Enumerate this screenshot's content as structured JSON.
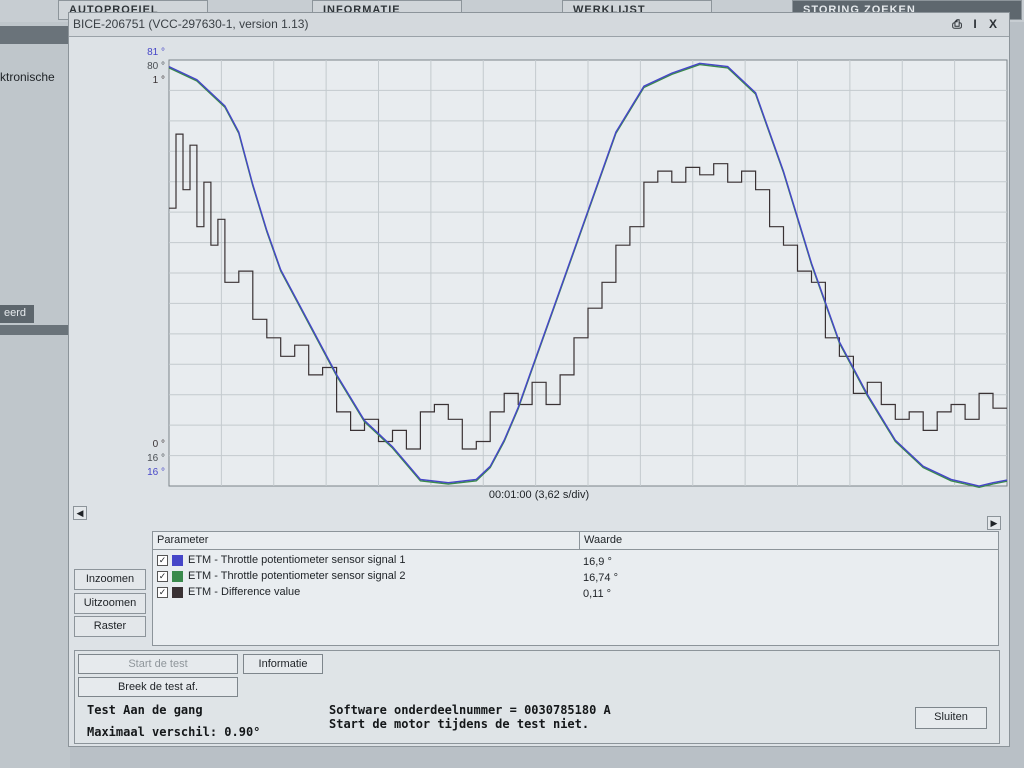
{
  "top_tabs": [
    "AUTOPROFIEL",
    "INFORMATIE",
    "WERKLIJST",
    "STORING ZOEKEN"
  ],
  "left_nav": {
    "label": "ktronische",
    "tab": "eerd"
  },
  "window": {
    "title": "BICE-206751 (VCC-297630-1, version 1.13)",
    "buttons": [
      "I",
      "X"
    ]
  },
  "colors": {
    "signal1": "#4646c8",
    "signal2": "#3a8a4c",
    "difference": "#3a3234"
  },
  "chart_data": {
    "type": "line",
    "x_label": "00:01:00 (3,62 s/div)",
    "y_top_labels": [
      {
        "text": "81 °",
        "color": "#4646c8"
      },
      {
        "text": "80 °",
        "color": "#4a4f54"
      },
      {
        "text": "1 °",
        "color": "#3a3234"
      }
    ],
    "y_bottom_labels": [
      {
        "text": "0 °",
        "color": "#3a3234"
      },
      {
        "text": "16 °",
        "color": "#4a4f54"
      },
      {
        "text": "16 °",
        "color": "#4646c8"
      }
    ],
    "grid": true,
    "x_range_s": [
      0,
      60
    ],
    "series": [
      {
        "name": "ETM - Throttle potentiometer sensor signal 1",
        "color": "#4646c8",
        "x": [
          0,
          2,
          4,
          5,
          6,
          7,
          8,
          9,
          10,
          12,
          14,
          16,
          18,
          20,
          22,
          23,
          24,
          25,
          26,
          28,
          30,
          32,
          34,
          36,
          38,
          40,
          42,
          44,
          46,
          48,
          50,
          52,
          54,
          56,
          57,
          58,
          59,
          60
        ],
        "y": [
          80,
          78,
          74,
          70,
          62,
          55,
          49,
          45,
          41,
          33,
          26,
          22,
          17,
          16.5,
          17,
          19,
          23,
          28,
          34,
          46,
          58,
          70,
          77,
          79,
          80.5,
          80,
          76,
          64,
          50,
          38,
          30,
          23,
          19,
          17,
          16.5,
          16,
          16.5,
          16.9
        ]
      },
      {
        "name": "ETM - Throttle potentiometer sensor signal 2",
        "color": "#3a8a4c",
        "x": [
          0,
          2,
          4,
          5,
          6,
          7,
          8,
          9,
          10,
          12,
          14,
          16,
          18,
          20,
          22,
          23,
          24,
          25,
          26,
          28,
          30,
          32,
          34,
          36,
          38,
          40,
          42,
          44,
          46,
          48,
          50,
          52,
          54,
          56,
          57,
          58,
          59,
          60
        ],
        "y": [
          79.8,
          77.8,
          73.8,
          69.8,
          61.8,
          54.8,
          48.8,
          44.8,
          40.8,
          32.8,
          25.8,
          21.8,
          16.8,
          16.3,
          16.8,
          18.8,
          22.8,
          27.8,
          33.8,
          45.8,
          57.8,
          69.8,
          76.8,
          78.8,
          80.3,
          79.8,
          75.8,
          63.8,
          49.8,
          37.8,
          29.8,
          22.8,
          18.8,
          16.8,
          16.3,
          15.8,
          16.3,
          16.74
        ]
      },
      {
        "name": "ETM - Difference value",
        "color": "#3a3234",
        "x": [
          0,
          0.5,
          1,
          1.5,
          2,
          2.5,
          3,
          3.5,
          4,
          5,
          6,
          7,
          8,
          9,
          10,
          11,
          12,
          13,
          14,
          15,
          16,
          17,
          18,
          19,
          20,
          21,
          22,
          23,
          24,
          25,
          26,
          27,
          28,
          29,
          30,
          31,
          32,
          33,
          34,
          35,
          36,
          37,
          38,
          39,
          40,
          41,
          42,
          43,
          44,
          45,
          46,
          47,
          48,
          49,
          50,
          51,
          52,
          53,
          54,
          55,
          56,
          57,
          58,
          59,
          60
        ],
        "y": [
          0.65,
          0.85,
          0.7,
          0.82,
          0.6,
          0.72,
          0.55,
          0.62,
          0.45,
          0.48,
          0.35,
          0.3,
          0.25,
          0.28,
          0.2,
          0.22,
          0.1,
          0.05,
          0.08,
          0.02,
          0.05,
          0.0,
          0.1,
          0.12,
          0.08,
          0.0,
          0.02,
          0.1,
          0.15,
          0.12,
          0.18,
          0.12,
          0.2,
          0.3,
          0.38,
          0.45,
          0.55,
          0.6,
          0.72,
          0.75,
          0.72,
          0.76,
          0.74,
          0.77,
          0.72,
          0.75,
          0.7,
          0.6,
          0.55,
          0.48,
          0.45,
          0.3,
          0.25,
          0.15,
          0.18,
          0.12,
          0.08,
          0.1,
          0.05,
          0.1,
          0.12,
          0.08,
          0.15,
          0.11,
          0.11
        ]
      }
    ]
  },
  "side_buttons": [
    "Inzoomen",
    "Uitzoomen",
    "Raster"
  ],
  "param_table": {
    "headers": [
      "Parameter",
      "Waarde"
    ],
    "rows": [
      {
        "name": "ETM - Throttle potentiometer sensor signal 1",
        "value": "16,9 °",
        "color": "#4646c8",
        "checked": true
      },
      {
        "name": "ETM - Throttle potentiometer sensor signal 2",
        "value": "16,74 °",
        "color": "#3a8a4c",
        "checked": true
      },
      {
        "name": "ETM - Difference value",
        "value": "0,11 °",
        "color": "#3a3234",
        "checked": true
      }
    ]
  },
  "actions": {
    "start": "Start de test",
    "info": "Informatie",
    "abort": "Breek de test af.",
    "close": "Sluiten"
  },
  "status": {
    "test": "Test  Aan de gang",
    "max_diff": "Maximaal verschil: 0.90°",
    "software": "Software onderdeelnummer = 0030785180  A",
    "warning": "Start de motor tijdens de test niet."
  }
}
